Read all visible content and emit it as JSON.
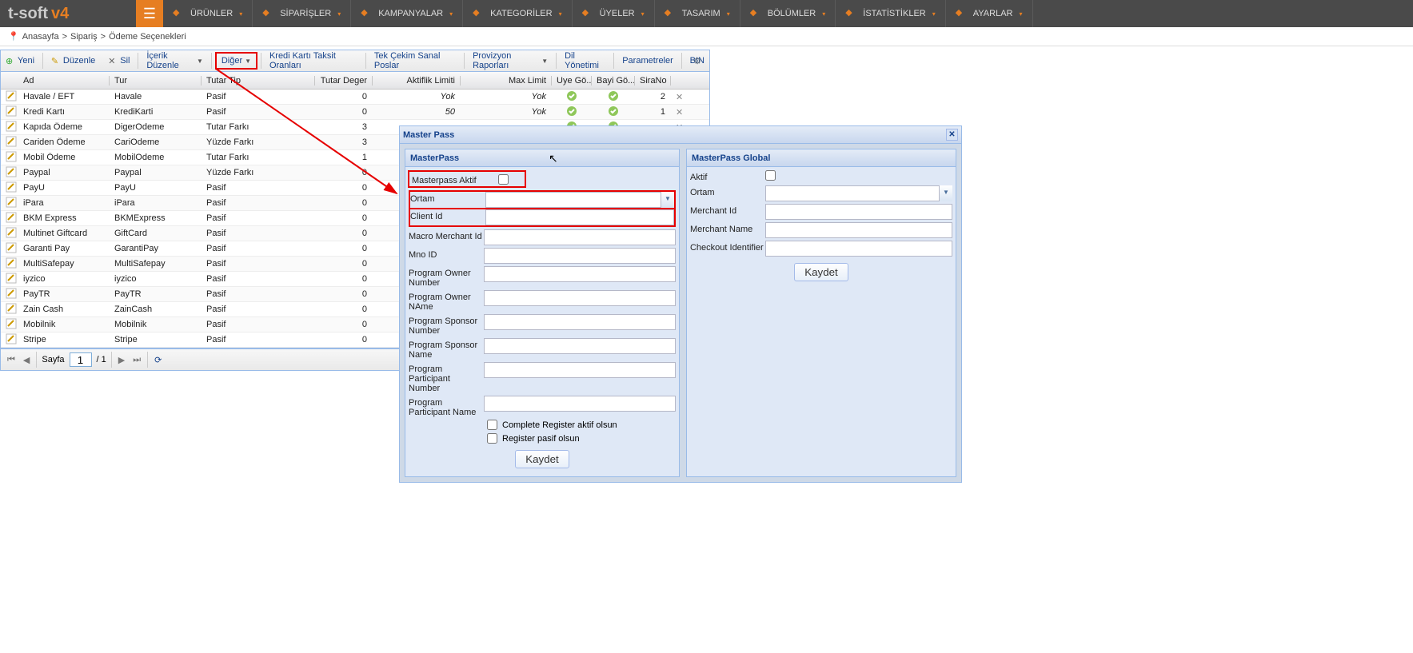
{
  "logo": {
    "text": "t-soft",
    "v": "v4"
  },
  "nav": [
    {
      "label": "ÜRÜNLER"
    },
    {
      "label": "SİPARİŞLER"
    },
    {
      "label": "KAMPANYALAR"
    },
    {
      "label": "KATEGORİLER"
    },
    {
      "label": "ÜYELER"
    },
    {
      "label": "TASARIM"
    },
    {
      "label": "BÖLÜMLER"
    },
    {
      "label": "İSTATİSTİKLER"
    },
    {
      "label": "AYARLAR"
    }
  ],
  "breadcrumb": [
    "Anasayfa",
    "Sipariş",
    "Ödeme Seçenekleri"
  ],
  "toolbar": {
    "yeni": "Yeni",
    "duzenle": "Düzenle",
    "sil": "Sil",
    "icerik": "İçerik Düzenle",
    "diger": "Diğer",
    "kredi": "Kredi Kartı Taksit Oranları",
    "tek": "Tek Çekim Sanal Poslar",
    "prov": "Provizyon Raporları",
    "dil": "Dil Yönetimi",
    "param": "Parametreler",
    "bin": "BIN"
  },
  "columns": {
    "ad": "Ad",
    "tur": "Tur",
    "tip": "Tutar Tip",
    "deg": "Tutar Deger",
    "ak": "Aktiflik Limiti",
    "max": "Max Limit",
    "uye": "Uye Gö...",
    "bayi": "Bayi Gö...",
    "sira": "SiraNo"
  },
  "rows": [
    {
      "ad": "Havale / EFT",
      "tur": "Havale",
      "tip": "Pasif",
      "deg": "0",
      "ak": "Yok",
      "max": "Yok",
      "sira": "2"
    },
    {
      "ad": "Kredi Kartı",
      "tur": "KrediKarti",
      "tip": "Pasif",
      "deg": "0",
      "ak": "50",
      "max": "Yok",
      "sira": "1"
    },
    {
      "ad": "Kapıda Ödeme",
      "tur": "DigerOdeme",
      "tip": "Tutar Farkı",
      "deg": "3",
      "ak": "",
      "max": "",
      "sira": ""
    },
    {
      "ad": "Cariden Ödeme",
      "tur": "CariOdeme",
      "tip": "Yüzde Farkı",
      "deg": "3",
      "ak": "",
      "max": "",
      "sira": ""
    },
    {
      "ad": "Mobil Ödeme",
      "tur": "MobilOdeme",
      "tip": "Tutar Farkı",
      "deg": "1",
      "ak": "",
      "max": "",
      "sira": ""
    },
    {
      "ad": "Paypal",
      "tur": "Paypal",
      "tip": "Yüzde Farkı",
      "deg": "0",
      "ak": "",
      "max": "",
      "sira": ""
    },
    {
      "ad": "PayU",
      "tur": "PayU",
      "tip": "Pasif",
      "deg": "0",
      "ak": "",
      "max": "",
      "sira": ""
    },
    {
      "ad": "iPara",
      "tur": "iPara",
      "tip": "Pasif",
      "deg": "0",
      "ak": "",
      "max": "",
      "sira": ""
    },
    {
      "ad": "BKM Express",
      "tur": "BKMExpress",
      "tip": "Pasif",
      "deg": "0",
      "ak": "",
      "max": "",
      "sira": ""
    },
    {
      "ad": "Multinet Giftcard",
      "tur": "GiftCard",
      "tip": "Pasif",
      "deg": "0",
      "ak": "",
      "max": "",
      "sira": ""
    },
    {
      "ad": "Garanti Pay",
      "tur": "GarantiPay",
      "tip": "Pasif",
      "deg": "0",
      "ak": "",
      "max": "",
      "sira": ""
    },
    {
      "ad": "MultiSafepay",
      "tur": "MultiSafepay",
      "tip": "Pasif",
      "deg": "0",
      "ak": "",
      "max": "",
      "sira": ""
    },
    {
      "ad": "iyzico",
      "tur": "iyzico",
      "tip": "Pasif",
      "deg": "0",
      "ak": "",
      "max": "",
      "sira": ""
    },
    {
      "ad": "PayTR",
      "tur": "PayTR",
      "tip": "Pasif",
      "deg": "0",
      "ak": "",
      "max": "",
      "sira": ""
    },
    {
      "ad": "Zain Cash",
      "tur": "ZainCash",
      "tip": "Pasif",
      "deg": "0",
      "ak": "",
      "max": "",
      "sira": ""
    },
    {
      "ad": "Mobilnik",
      "tur": "Mobilnik",
      "tip": "Pasif",
      "deg": "0",
      "ak": "",
      "max": "",
      "sira": ""
    },
    {
      "ad": "Stripe",
      "tur": "Stripe",
      "tip": "Pasif",
      "deg": "0",
      "ak": "",
      "max": "",
      "sira": ""
    }
  ],
  "pager": {
    "label": "Sayfa",
    "page": "1",
    "total": "/ 1"
  },
  "modal": {
    "title": "Master Pass",
    "left": {
      "title": "MasterPass",
      "aktif_label": "Masterpass Aktif",
      "ortam": "Ortam",
      "client": "Client Id",
      "macro": "Macro Merchant Id",
      "mno": "Mno ID",
      "pon": "Program Owner Number",
      "poname": "Program Owner NAme",
      "psn": "Program Sponsor Number",
      "psname": "Program Sponsor Name",
      "ppn": "Program Participant Number",
      "ppname": "Program Participant Name",
      "cb1": "Complete Register aktif olsun",
      "cb2": "Register pasif olsun",
      "save": "Kaydet"
    },
    "right": {
      "title": "MasterPass Global",
      "aktif": "Aktif",
      "ortam": "Ortam",
      "mid": "Merchant Id",
      "mname": "Merchant Name",
      "chk": "Checkout Identifier",
      "save": "Kaydet"
    }
  }
}
